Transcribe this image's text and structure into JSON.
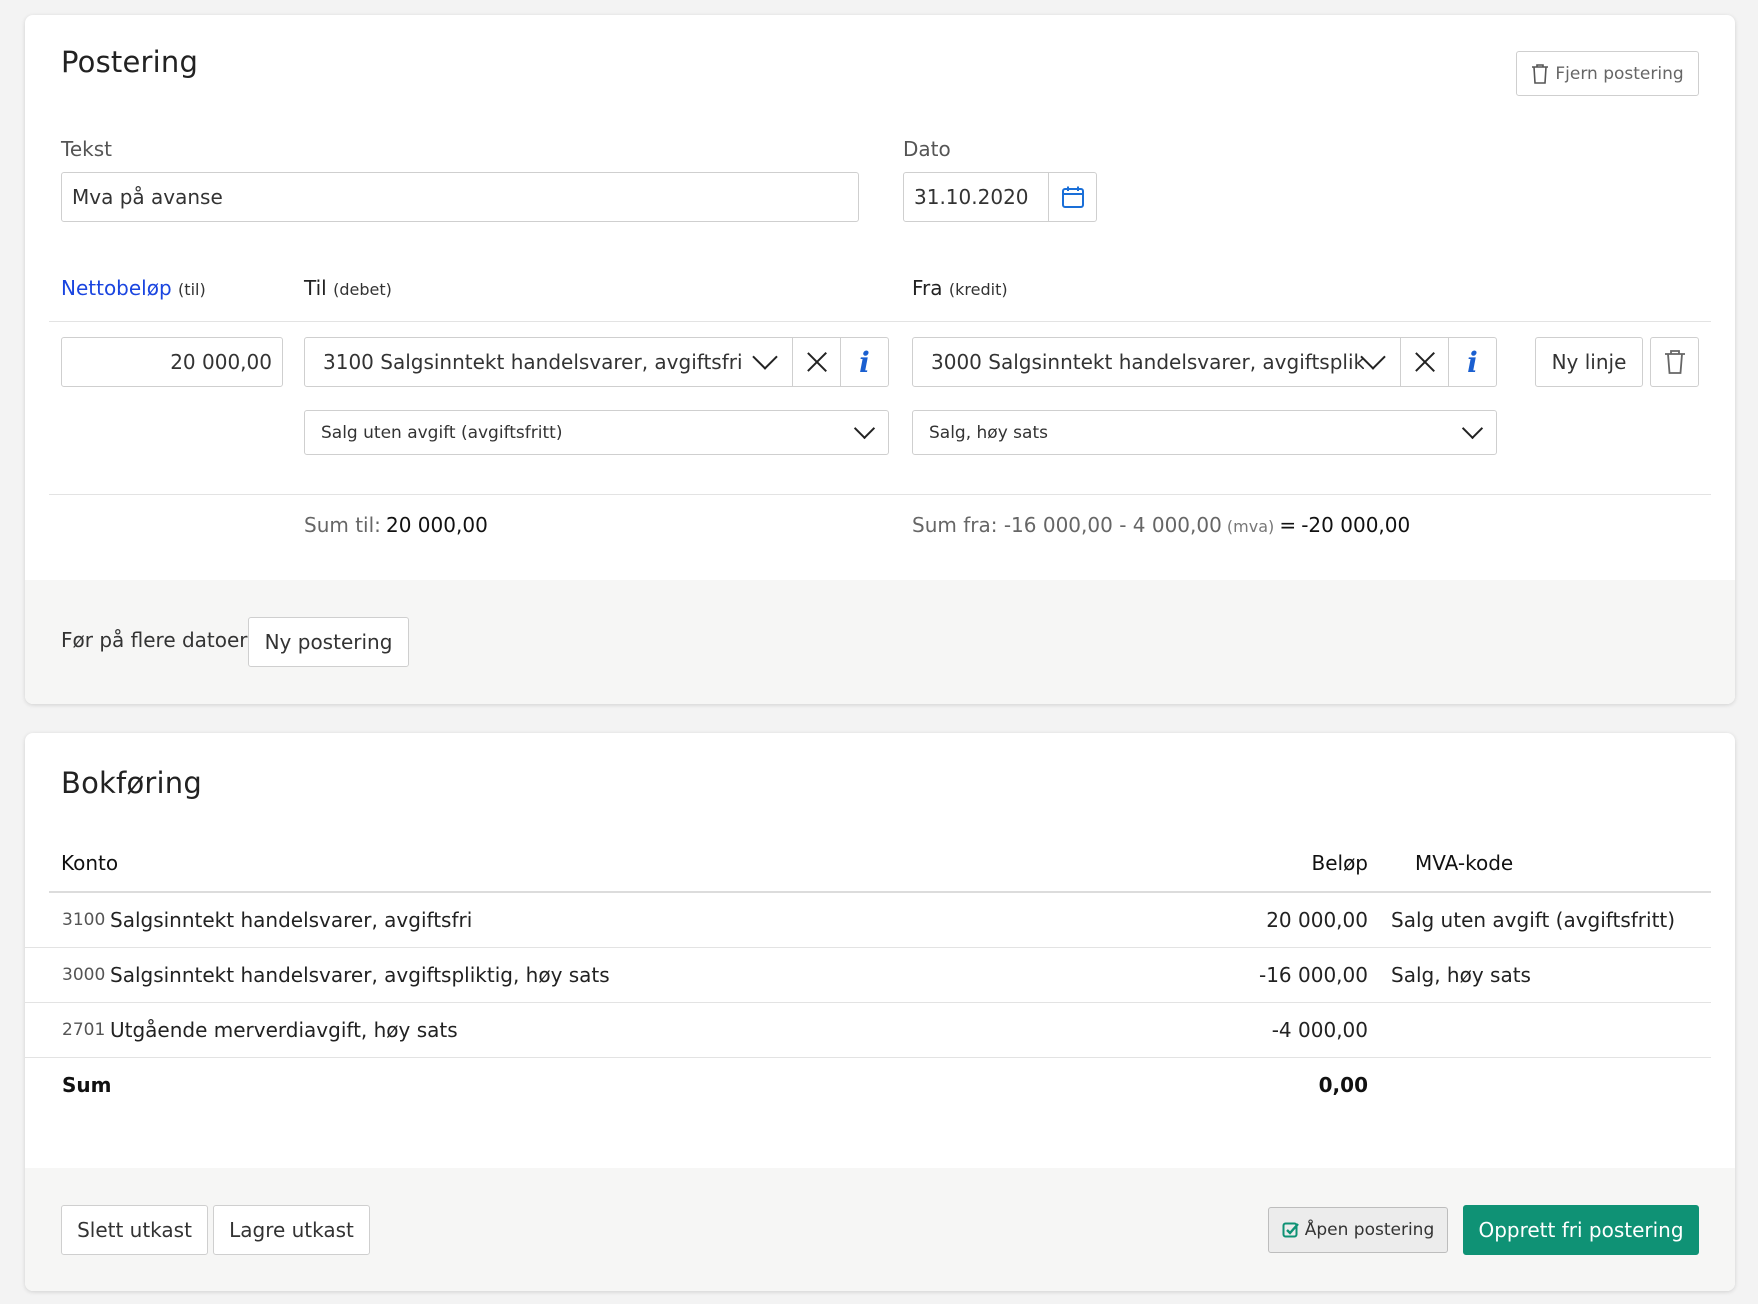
{
  "postering": {
    "title": "Postering",
    "remove_label": "Fjern postering",
    "tekst_label": "Tekst",
    "tekst_value": "Mva på avanse",
    "dato_label": "Dato",
    "dato_value": "31.10.2020",
    "col_netto": "Nettobeløp",
    "col_netto_sub": "(til)",
    "col_til": "Til",
    "col_til_sub": "(debet)",
    "col_fra": "Fra",
    "col_fra_sub": "(kredit)",
    "line": {
      "amount": "20 000,00",
      "til_account": "3100 Salgsinntekt handelsvarer, avgiftsfri",
      "fra_account": "3000 Salgsinntekt handelsvarer, avgiftsplik...",
      "til_vat": "Salg uten avgift (avgiftsfritt)",
      "fra_vat": "Salg, høy sats",
      "new_line_label": "Ny linje"
    },
    "sum_til_label": "Sum til:",
    "sum_til_value": "20 000,00",
    "sum_fra_label": "Sum fra: -16 000,00 - 4 000,00",
    "sum_fra_mva": "(mva)",
    "sum_fra_eq": "=",
    "sum_fra_value": "-20 000,00",
    "multi_label": "Før på flere datoer:",
    "multi_button": "Ny postering"
  },
  "bokforing": {
    "title": "Bokføring",
    "headers": {
      "konto": "Konto",
      "belop": "Beløp",
      "mva": "MVA-kode"
    },
    "rows": [
      {
        "num": "3100",
        "name": "Salgsinntekt handelsvarer, avgiftsfri",
        "amount": "20 000,00",
        "mva": "Salg uten avgift (avgiftsfritt)"
      },
      {
        "num": "3000",
        "name": "Salgsinntekt handelsvarer, avgiftspliktig, høy sats",
        "amount": "-16 000,00",
        "mva": "Salg, høy sats"
      },
      {
        "num": "2701",
        "name": "Utgående merverdiavgift, høy sats",
        "amount": "-4 000,00",
        "mva": ""
      }
    ],
    "sum_label": "Sum",
    "sum_value": "0,00"
  },
  "actions": {
    "delete_draft": "Slett utkast",
    "save_draft": "Lagre utkast",
    "open_posting": "Åpen postering",
    "create": "Opprett fri postering"
  },
  "colors": {
    "primary_green": "#0f9275",
    "link_blue": "#1a45e0",
    "info_blue": "#1a5fd0"
  },
  "icons": [
    "trash-icon",
    "calendar-icon",
    "chevron-down-icon",
    "close-icon",
    "info-icon",
    "checkbox-checked-icon"
  ]
}
